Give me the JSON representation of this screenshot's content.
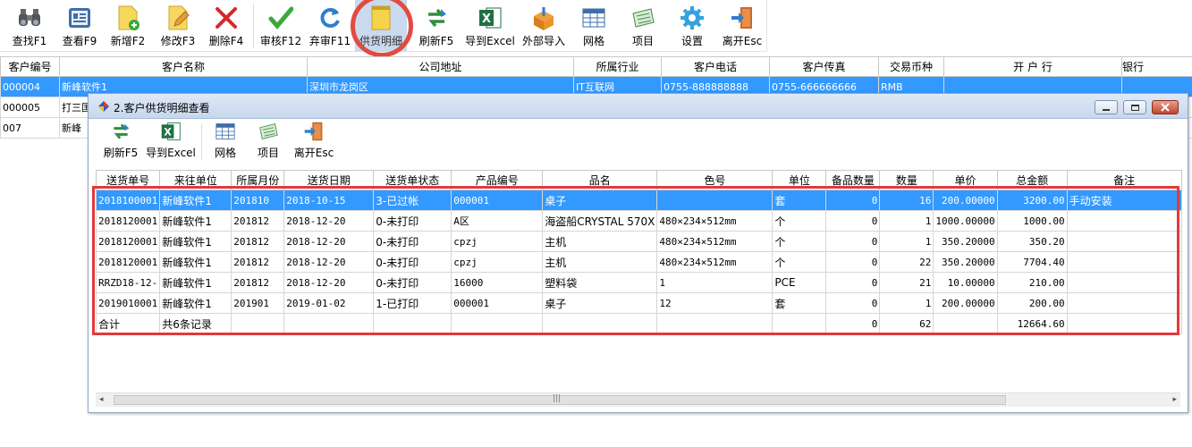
{
  "toolbar": {
    "items": [
      {
        "label": "查找F1",
        "icon": "binoculars-icon"
      },
      {
        "label": "查看F9",
        "icon": "view-card-icon"
      },
      {
        "label": "新增F2",
        "icon": "new-doc-icon"
      },
      {
        "label": "修改F3",
        "icon": "edit-doc-icon"
      },
      {
        "label": "删除F4",
        "icon": "delete-x-icon"
      },
      {
        "label": "审核F12",
        "icon": "checkmark-icon"
      },
      {
        "label": "弃审F11",
        "icon": "refresh-icon"
      },
      {
        "label": "供货明细",
        "icon": "notepad-icon"
      },
      {
        "label": "刷新F5",
        "icon": "swap-arrows-icon"
      },
      {
        "label": "导到Excel",
        "icon": "excel-icon"
      },
      {
        "label": "外部导入",
        "icon": "box-import-icon"
      },
      {
        "label": "网格",
        "icon": "grid-icon"
      },
      {
        "label": "项目",
        "icon": "project-icon"
      },
      {
        "label": "设置",
        "icon": "gear-icon"
      },
      {
        "label": "离开Esc",
        "icon": "exit-door-icon"
      }
    ]
  },
  "customers": {
    "columns": [
      "客户编号",
      "客户名称",
      "公司地址",
      "所属行业",
      "客户电话",
      "客户传真",
      "交易币种",
      "开 户 行",
      "银行"
    ],
    "rows": [
      [
        "000004",
        "新峰软件1",
        "深圳市龙岗区",
        "IT互联网",
        "0755-888888888",
        "0755-666666666",
        "RMB",
        "",
        ""
      ],
      [
        "000005",
        "打三国",
        "",
        "",
        "",
        "",
        "",
        "",
        ""
      ],
      [
        "007",
        "新峰",
        "",
        "",
        "",
        "",
        "",
        "",
        ""
      ]
    ]
  },
  "dialog": {
    "title": "2.客户供货明细查看",
    "toolbar": [
      {
        "label": "刷新F5",
        "icon": "swap-arrows-icon"
      },
      {
        "label": "导到Excel",
        "icon": "excel-icon"
      },
      {
        "label": "网格",
        "icon": "grid-icon"
      },
      {
        "label": "项目",
        "icon": "project-icon"
      },
      {
        "label": "离开Esc",
        "icon": "exit-door-icon"
      }
    ],
    "columns": [
      "送货单号",
      "来往单位",
      "所属月份",
      "送货日期",
      "送货单状态",
      "产品编号",
      "品名",
      "色号",
      "单位",
      "备品数量",
      "数量",
      "单价",
      "总金额",
      "备注"
    ],
    "rows": [
      [
        "2018100001",
        "新峰软件1",
        "201810",
        "2018-10-15",
        "3-已过帐",
        "000001",
        "桌子",
        "",
        "套",
        "0",
        "16",
        "200.00000",
        "3200.00",
        "手动安装"
      ],
      [
        "2018120001",
        "新峰软件1",
        "201812",
        "2018-12-20",
        "0-未打印",
        "A区",
        "海盗船CRYSTAL 570X",
        "480×234×512mm",
        "个",
        "0",
        "1",
        "1000.00000",
        "1000.00",
        ""
      ],
      [
        "2018120001",
        "新峰软件1",
        "201812",
        "2018-12-20",
        "0-未打印",
        "cpzj",
        "主机",
        "480×234×512mm",
        "个",
        "0",
        "1",
        "350.20000",
        "350.20",
        ""
      ],
      [
        "2018120001",
        "新峰软件1",
        "201812",
        "2018-12-20",
        "0-未打印",
        "cpzj",
        "主机",
        "480×234×512mm",
        "个",
        "0",
        "22",
        "350.20000",
        "7704.40",
        ""
      ],
      [
        "RRZD18-12-",
        "新峰软件1",
        "201812",
        "2018-12-20",
        "0-未打印",
        "16000",
        "塑料袋",
        "1",
        "PCE",
        "0",
        "21",
        "10.00000",
        "210.00",
        ""
      ],
      [
        "2019010001",
        "新峰软件1",
        "201901",
        "2019-01-02",
        "1-已打印",
        "000001",
        "桌子",
        "12",
        "套",
        "0",
        "1",
        "200.00000",
        "200.00",
        ""
      ],
      [
        "合计",
        "共6条记录",
        "",
        "",
        "",
        "",
        "",
        "",
        "",
        "0",
        "62",
        "",
        "12664.60",
        ""
      ]
    ]
  },
  "colors": {
    "selection": "#3399ff",
    "highlight": "#e03a3a"
  }
}
